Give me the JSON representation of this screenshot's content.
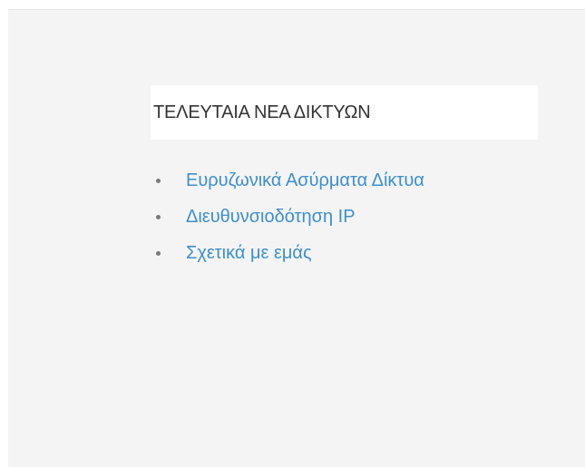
{
  "widget": {
    "title": "ΤΕΛΕΥΤΑΙΑ ΝΕΑ ΔΙΚΤΥΩΝ",
    "links": [
      {
        "label": "Ευρυζωνικά Ασύρματα Δίκτυα"
      },
      {
        "label": "Διευθυνσιοδότηση IP"
      },
      {
        "label": "Σχετικά με εμάς"
      }
    ]
  },
  "colors": {
    "link": "#3d8fd0",
    "background": "#f4f4f4",
    "title_box": "#ffffff"
  }
}
